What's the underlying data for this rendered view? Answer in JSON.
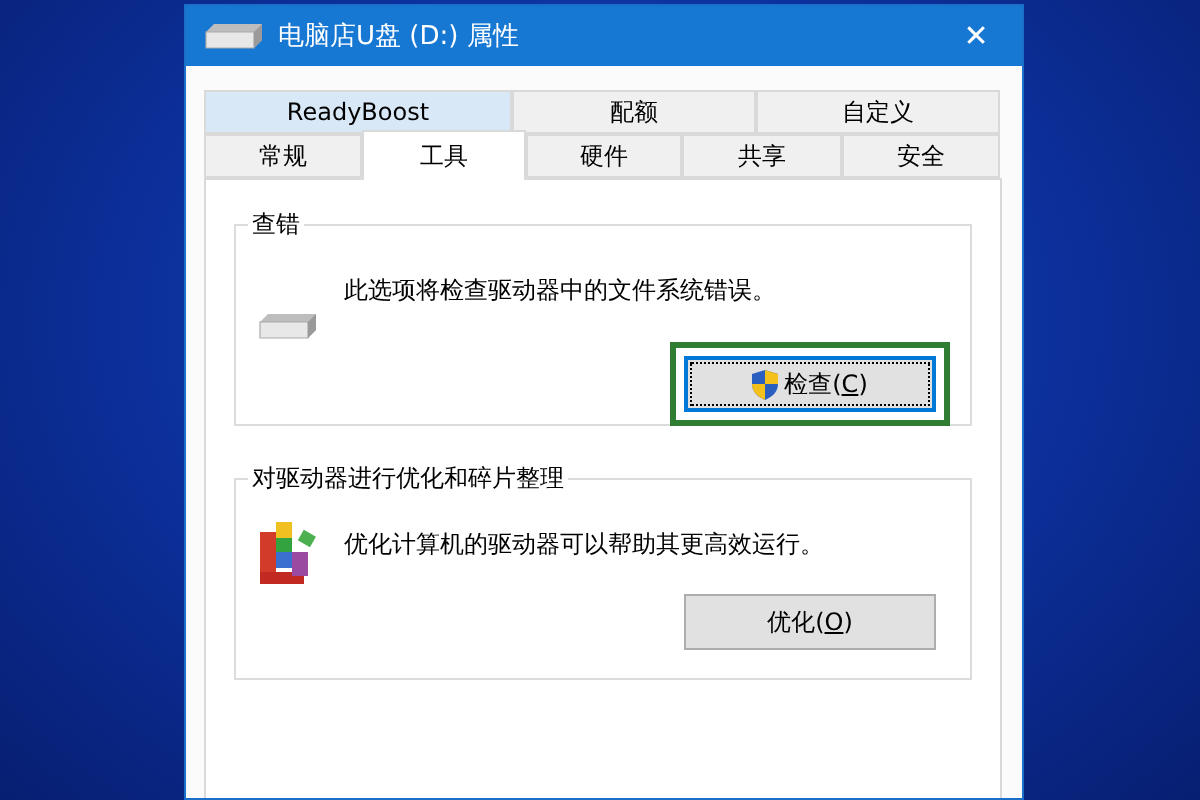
{
  "window": {
    "title": "电脑店U盘 (D:) 属性",
    "close": "✕"
  },
  "tab_rows": [
    [
      {
        "label": "ReadyBoost",
        "selected": false,
        "hovered": true
      },
      {
        "label": "配额",
        "selected": false,
        "hovered": false
      },
      {
        "label": "自定义",
        "selected": false,
        "hovered": false
      }
    ],
    [
      {
        "label": "常规",
        "selected": false,
        "hovered": false
      },
      {
        "label": "工具",
        "selected": true,
        "hovered": false
      },
      {
        "label": "硬件",
        "selected": false,
        "hovered": false
      },
      {
        "label": "共享",
        "selected": false,
        "hovered": false
      },
      {
        "label": "安全",
        "selected": false,
        "hovered": false
      }
    ]
  ],
  "groups": [
    {
      "title": "查错",
      "kind": "drive",
      "text": "此选项将检查驱动器中的文件系统错误。",
      "button": {
        "label": "检查(",
        "mnemonic": "C",
        "label_end": ")",
        "shield": true,
        "focused": true,
        "highlighted": true
      }
    },
    {
      "title": "对驱动器进行优化和碎片整理",
      "kind": "defrag",
      "text": "优化计算机的驱动器可以帮助其更高效运行。",
      "button": {
        "label": "优化(",
        "mnemonic": "O",
        "label_end": ")",
        "shield": false,
        "focused": false,
        "highlighted": false
      }
    }
  ]
}
